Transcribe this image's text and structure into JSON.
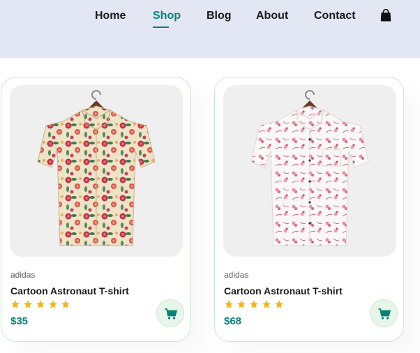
{
  "nav": {
    "items": [
      {
        "label": "Home",
        "active": false
      },
      {
        "label": "Shop",
        "active": true
      },
      {
        "label": "Blog",
        "active": false
      },
      {
        "label": "About",
        "active": false
      },
      {
        "label": "Contact",
        "active": false
      }
    ],
    "cart_icon": "shopping-bag-icon"
  },
  "colors": {
    "header_bg": "#e3e6f3",
    "accent": "#088178",
    "star": "#f3b519",
    "card_border": "#cce7d0",
    "cart_bg": "#e8f6ea"
  },
  "products": [
    {
      "brand": "adidas",
      "name": "Cartoon Astronaut T-shirt",
      "rating": 5,
      "price": "$35",
      "image": "floral-shirt-beige"
    },
    {
      "brand": "adidas",
      "name": "Cartoon Astronaut T-shirt",
      "rating": 5,
      "price": "$68",
      "image": "floral-shirt-white"
    }
  ]
}
